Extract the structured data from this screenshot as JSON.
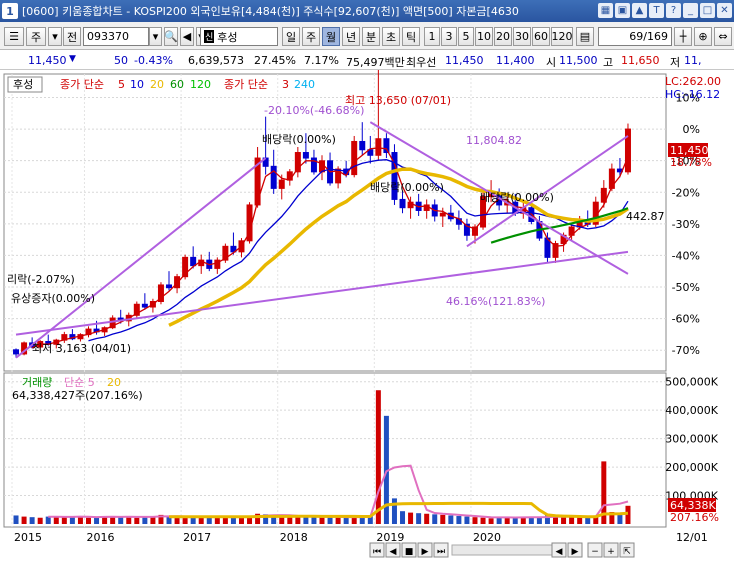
{
  "titlebar": {
    "num": "1",
    "text": "[0600] 키움종합차트 - KOSPI200 외국인보유[4,484(천)] 주식수[92,607(천)] 액면[500] 자본금[4630",
    "icons": [
      "▦",
      "▣",
      "▲",
      "T",
      "?",
      "_",
      "□",
      "✕"
    ]
  },
  "toolbar": {
    "market": "주",
    "all": "전",
    "code": "093370",
    "name": "후성",
    "periods": [
      "일",
      "주",
      "월",
      "년",
      "분",
      "초",
      "틱"
    ],
    "selected_period": "월",
    "intervals": [
      "1",
      "3",
      "5",
      "10",
      "20",
      "30",
      "60",
      "120"
    ],
    "page_count": "69/169"
  },
  "quote": {
    "price": "11,450",
    "change": "50",
    "change_pct": "-0.43%",
    "volume": "6,639,573",
    "vol_rate": "27.45%",
    "turnover": "7.17%",
    "amount": "75,497백만",
    "best_ask_label": "최우선",
    "best_ask": "11,450",
    "best_bid": "11,400",
    "open_label": "시",
    "open": "11,500",
    "high_label": "고",
    "high": "11,650",
    "low_label": "저",
    "low": "11,"
  },
  "chart_data": {
    "type": "candlestick",
    "legend": {
      "stock": "후성",
      "ma_prefix": "종가 단순",
      "ma_periods": [
        "5",
        "10",
        "20",
        "60",
        "120"
      ],
      "ma_colors": [
        "#d00000",
        "#0000d0",
        "#e8b800",
        "#009000",
        "#00c000"
      ],
      "ma2_prefix": "종가 단순",
      "ma2_periods": [
        "3",
        "240"
      ],
      "ma2_colors": [
        "#d00000",
        "#00b0f0"
      ]
    },
    "lc_hc": {
      "lc": "LC:262.00",
      "hc": "HC:-16.12"
    },
    "price_axis_ticks": [
      "10%",
      "0%",
      "-10%",
      "-20%",
      "-30%",
      "-40%",
      "-50%",
      "-60%",
      "-70%"
    ],
    "volume_axis_ticks": [
      "500,000K",
      "400,000K",
      "300,000K",
      "200,000K",
      "100,000K"
    ],
    "x_axis_ticks": [
      "2015",
      "2016",
      "2017",
      "2018",
      "2019",
      "2020",
      "12/01"
    ],
    "current_price_label": "11,450",
    "current_pct_label": "18.78%",
    "current_vol_label": "64,338K",
    "current_vol_pct_label": "207.16%",
    "volume_legend": {
      "name": "거래량",
      "ma": "단순 5",
      "ma2": "20"
    },
    "volume_info": "64,338,427주(207.16%)",
    "annotations": {
      "rights": "리락(-2.07%)",
      "paid_in": "유상증자(0.00%)",
      "low": "최저 3,163 (04/01)",
      "high": "최고 13,650 (07/01)",
      "div1": "배당락(0.00%)",
      "div2": "배당락(0.00%)",
      "div3": "배당락(0.00%)",
      "pct1": "-20.10%(-46.68%)",
      "pct2": "11,804.82",
      "pct3": "46.16%(121.83%)",
      "pct4": "442.87"
    },
    "candles": [
      [
        3450,
        3500,
        3163,
        3300
      ],
      [
        3300,
        3750,
        3250,
        3700
      ],
      [
        3700,
        3900,
        3500,
        3550
      ],
      [
        3550,
        3800,
        3450,
        3750
      ],
      [
        3750,
        4000,
        3600,
        3650
      ],
      [
        3650,
        3850,
        3500,
        3800
      ],
      [
        3800,
        4100,
        3700,
        4000
      ],
      [
        4000,
        4200,
        3800,
        3850
      ],
      [
        3850,
        4050,
        3750,
        4000
      ],
      [
        4000,
        4300,
        3900,
        4200
      ],
      [
        4200,
        4500,
        4000,
        4100
      ],
      [
        4100,
        4300,
        3950,
        4250
      ],
      [
        4250,
        4700,
        4200,
        4600
      ],
      [
        4600,
        4900,
        4400,
        4500
      ],
      [
        4500,
        4800,
        4300,
        4700
      ],
      [
        4700,
        5200,
        4600,
        5100
      ],
      [
        5100,
        5500,
        4900,
        5000
      ],
      [
        5000,
        5300,
        4800,
        5200
      ],
      [
        5200,
        5900,
        5100,
        5800
      ],
      [
        5800,
        6300,
        5600,
        5700
      ],
      [
        5700,
        6200,
        5500,
        6100
      ],
      [
        6100,
        6900,
        6000,
        6800
      ],
      [
        6800,
        7200,
        6400,
        6500
      ],
      [
        6500,
        6900,
        6200,
        6700
      ],
      [
        6700,
        7000,
        6300,
        6400
      ],
      [
        6400,
        6800,
        6200,
        6700
      ],
      [
        6700,
        7300,
        6600,
        7200
      ],
      [
        7200,
        7700,
        6900,
        7000
      ],
      [
        7000,
        7500,
        6800,
        7400
      ],
      [
        7400,
        8800,
        7300,
        8700
      ],
      [
        8700,
        10800,
        8600,
        10400
      ],
      [
        10400,
        11900,
        9800,
        10100
      ],
      [
        10100,
        10700,
        9100,
        9300
      ],
      [
        9300,
        9800,
        8900,
        9600
      ],
      [
        9600,
        10000,
        9400,
        9900
      ],
      [
        9900,
        10800,
        9700,
        10600
      ],
      [
        10600,
        11300,
        10200,
        10400
      ],
      [
        10400,
        10700,
        9800,
        9900
      ],
      [
        9900,
        10500,
        9600,
        10300
      ],
      [
        10300,
        10600,
        9400,
        9500
      ],
      [
        9500,
        10100,
        9300,
        10000
      ],
      [
        10000,
        10300,
        9700,
        9800
      ],
      [
        9800,
        11200,
        9700,
        11000
      ],
      [
        11000,
        11700,
        10500,
        10700
      ],
      [
        10700,
        11200,
        10200,
        10500
      ],
      [
        10500,
        13650,
        10300,
        11100
      ],
      [
        11100,
        11300,
        10400,
        10600
      ],
      [
        10600,
        10900,
        8700,
        8900
      ],
      [
        8900,
        9200,
        8400,
        8600
      ],
      [
        8600,
        9000,
        8200,
        8800
      ],
      [
        8800,
        9100,
        8300,
        8500
      ],
      [
        8500,
        8900,
        8200,
        8700
      ],
      [
        8700,
        8900,
        8100,
        8300
      ],
      [
        8300,
        8600,
        7900,
        8400
      ],
      [
        8400,
        8700,
        8100,
        8200
      ],
      [
        8200,
        8500,
        7800,
        8000
      ],
      [
        8000,
        8200,
        7400,
        7600
      ],
      [
        7600,
        8000,
        7300,
        7900
      ],
      [
        7900,
        9200,
        7800,
        9000
      ],
      [
        9000,
        9600,
        8800,
        9100
      ],
      [
        9100,
        9300,
        8500,
        8700
      ],
      [
        8700,
        9000,
        8400,
        8800
      ],
      [
        8800,
        9100,
        8300,
        8400
      ],
      [
        8400,
        8800,
        8200,
        8600
      ],
      [
        8600,
        8800,
        8000,
        8100
      ],
      [
        8100,
        8300,
        7400,
        7500
      ],
      [
        7500,
        7700,
        6600,
        6800
      ],
      [
        6800,
        7400,
        6600,
        7300
      ],
      [
        7300,
        7700,
        7000,
        7600
      ],
      [
        7600,
        8000,
        7400,
        7900
      ],
      [
        7900,
        8300,
        7800,
        8100
      ],
      [
        8100,
        8500,
        7900,
        8000
      ],
      [
        8000,
        9000,
        7900,
        8800
      ],
      [
        8800,
        9600,
        8600,
        9300
      ],
      [
        9300,
        10200,
        9200,
        10000
      ],
      [
        10000,
        10400,
        9700,
        9900
      ],
      [
        9900,
        11650,
        9800,
        11450
      ]
    ],
    "volumes": [
      30,
      26,
      24,
      22,
      26,
      28,
      24,
      25,
      27,
      22,
      24,
      26,
      28,
      24,
      25,
      22,
      26,
      28,
      32,
      26,
      24,
      22,
      26,
      28,
      24,
      26,
      22,
      24,
      26,
      28,
      36,
      34,
      30,
      28,
      24,
      26,
      28,
      25,
      24,
      26,
      24,
      22,
      26,
      24,
      28,
      470,
      380,
      90,
      45,
      40,
      38,
      36,
      34,
      32,
      30,
      28,
      26,
      24,
      22,
      20,
      24,
      26,
      22,
      24,
      22,
      24,
      30,
      26,
      24,
      28,
      26,
      24,
      30,
      220,
      42,
      40,
      64
    ]
  }
}
